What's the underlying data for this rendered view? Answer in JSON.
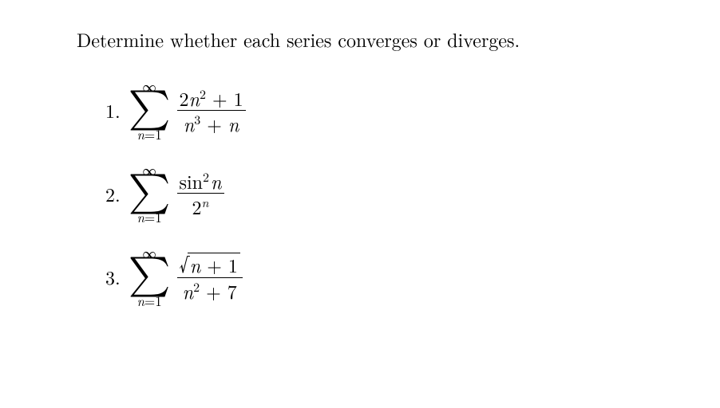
{
  "instruction": "Determine whether each series converges or diverges.",
  "problems": [
    {
      "number": "1.",
      "sigma_top": "∞",
      "sigma_bottom_var": "n",
      "sigma_bottom_eq": "=1",
      "numerator": {
        "expr": "2n^2 + 1",
        "parts": [
          "2",
          "n",
          "2",
          " + 1"
        ]
      },
      "denominator": {
        "expr": "n^3 + n",
        "parts": [
          "n",
          "3",
          " + ",
          "n"
        ]
      }
    },
    {
      "number": "2.",
      "sigma_top": "∞",
      "sigma_bottom_var": "n",
      "sigma_bottom_eq": "=1",
      "numerator": {
        "expr": "sin^2 n",
        "func": "sin",
        "exp": "2",
        "arg": "n"
      },
      "denominator": {
        "expr": "2^n",
        "base": "2",
        "exp": "n"
      }
    },
    {
      "number": "3.",
      "sigma_top": "∞",
      "sigma_bottom_var": "n",
      "sigma_bottom_eq": "=1",
      "numerator": {
        "expr": "sqrt(n + 1)",
        "radicand_var": "n",
        "radicand_rest": " + 1"
      },
      "denominator": {
        "expr": "n^2 + 7",
        "parts": [
          "n",
          "2",
          " + 7"
        ]
      }
    }
  ]
}
